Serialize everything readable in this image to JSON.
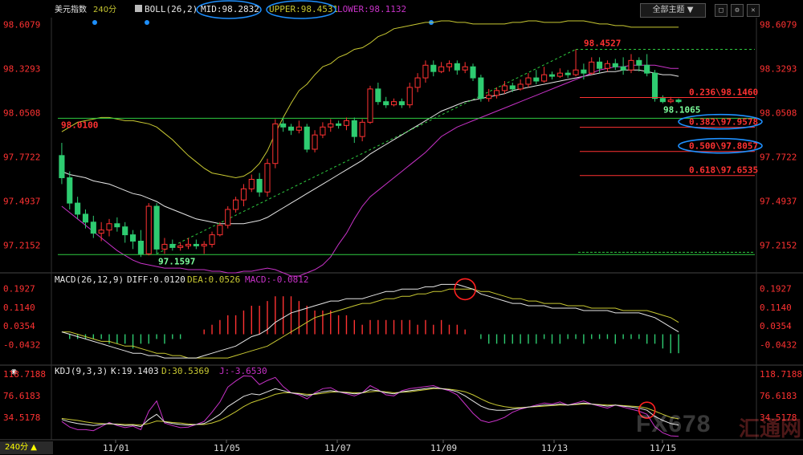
{
  "instrument": "美元指数",
  "period": "240分",
  "theme_button": "全部主题",
  "chart_data": {
    "type": "candlestick",
    "xlabels": [
      "11/01",
      "11/05",
      "11/07",
      "11/09",
      "11/13",
      "11/15"
    ],
    "y_ticks": [
      "98.6079",
      "98.3293",
      "98.0508",
      "97.7722",
      "97.4937",
      "97.2152"
    ],
    "ylim": [
      97.04,
      98.65
    ],
    "candles": [
      [
        97.78,
        97.64,
        97.86,
        97.6
      ],
      [
        97.64,
        97.48,
        97.68,
        97.44
      ],
      [
        97.48,
        97.41,
        97.52,
        97.38
      ],
      [
        97.41,
        97.36,
        97.44,
        97.32
      ],
      [
        97.36,
        97.29,
        97.4,
        97.26
      ],
      [
        97.29,
        97.31,
        97.36,
        97.24
      ],
      [
        97.31,
        97.35,
        97.38,
        97.27
      ],
      [
        97.35,
        97.33,
        97.39,
        97.3
      ],
      [
        97.33,
        97.28,
        97.36,
        97.23
      ],
      [
        97.28,
        97.24,
        97.31,
        97.19
      ],
      [
        97.24,
        97.16,
        97.31,
        97.14
      ],
      [
        97.16,
        97.46,
        97.48,
        97.15
      ],
      [
        97.46,
        97.19,
        97.48,
        97.16
      ],
      [
        97.19,
        97.22,
        97.26,
        97.16
      ],
      [
        97.22,
        97.2,
        97.25,
        97.18
      ],
      [
        97.2,
        97.21,
        97.23,
        97.18
      ],
      [
        97.21,
        97.22,
        97.26,
        97.19
      ],
      [
        97.22,
        97.21,
        97.25,
        97.19
      ],
      [
        97.21,
        97.22,
        97.24,
        97.16
      ],
      [
        97.22,
        97.28,
        97.3,
        97.2
      ],
      [
        97.28,
        97.34,
        97.36,
        97.27
      ],
      [
        97.34,
        97.44,
        97.46,
        97.32
      ],
      [
        97.44,
        97.5,
        97.52,
        97.42
      ],
      [
        97.5,
        97.57,
        97.6,
        97.46
      ],
      [
        97.57,
        97.63,
        97.66,
        97.55
      ],
      [
        97.63,
        97.55,
        97.67,
        97.52
      ],
      [
        97.55,
        97.73,
        97.76,
        97.52
      ],
      [
        97.73,
        97.98,
        98.01,
        97.7
      ],
      [
        97.98,
        97.96,
        98.02,
        97.93
      ],
      [
        97.96,
        97.94,
        97.98,
        97.91
      ],
      [
        97.94,
        97.96,
        98.0,
        97.92
      ],
      [
        97.96,
        97.82,
        97.98,
        97.8
      ],
      [
        97.82,
        97.91,
        97.94,
        97.8
      ],
      [
        97.91,
        97.96,
        97.99,
        97.89
      ],
      [
        97.96,
        97.98,
        98.01,
        97.93
      ],
      [
        97.98,
        97.97,
        98.0,
        97.95
      ],
      [
        97.97,
        98.0,
        98.02,
        97.94
      ],
      [
        98.0,
        97.9,
        98.02,
        97.86
      ],
      [
        97.9,
        97.99,
        98.01,
        97.87
      ],
      [
        97.99,
        98.2,
        98.22,
        97.98
      ],
      [
        98.2,
        98.12,
        98.24,
        98.1
      ],
      [
        98.12,
        98.1,
        98.15,
        98.08
      ],
      [
        98.1,
        98.12,
        98.14,
        98.09
      ],
      [
        98.12,
        98.1,
        98.14,
        98.08
      ],
      [
        98.1,
        98.21,
        98.24,
        98.08
      ],
      [
        98.21,
        98.27,
        98.3,
        98.18
      ],
      [
        98.27,
        98.35,
        98.38,
        98.24
      ],
      [
        98.35,
        98.31,
        98.38,
        98.28
      ],
      [
        98.31,
        98.34,
        98.37,
        98.3
      ],
      [
        98.34,
        98.36,
        98.38,
        98.31
      ],
      [
        98.36,
        98.32,
        98.38,
        98.29
      ],
      [
        98.32,
        98.34,
        98.37,
        98.3
      ],
      [
        98.34,
        98.27,
        98.36,
        98.25
      ],
      [
        98.27,
        98.14,
        98.29,
        98.12
      ],
      [
        98.14,
        98.16,
        98.2,
        98.12
      ],
      [
        98.16,
        98.19,
        98.21,
        98.14
      ],
      [
        98.19,
        98.22,
        98.25,
        98.17
      ],
      [
        98.22,
        98.2,
        98.24,
        98.18
      ],
      [
        98.2,
        98.23,
        98.26,
        98.19
      ],
      [
        98.23,
        98.27,
        98.3,
        98.21
      ],
      [
        98.27,
        98.25,
        98.32,
        98.23
      ],
      [
        98.25,
        98.29,
        98.34,
        98.24
      ],
      [
        98.29,
        98.28,
        98.31,
        98.26
      ],
      [
        98.28,
        98.3,
        98.33,
        98.27
      ],
      [
        98.3,
        98.29,
        98.32,
        98.27
      ],
      [
        98.29,
        98.32,
        98.45,
        98.28
      ],
      [
        98.32,
        98.3,
        98.36,
        98.26
      ],
      [
        98.3,
        98.37,
        98.4,
        98.29
      ],
      [
        98.37,
        98.33,
        98.4,
        98.3
      ],
      [
        98.33,
        98.36,
        98.38,
        98.31
      ],
      [
        98.36,
        98.34,
        98.39,
        98.32
      ],
      [
        98.34,
        98.32,
        98.4,
        98.29
      ],
      [
        98.32,
        98.38,
        98.42,
        98.3
      ],
      [
        98.38,
        98.35,
        98.4,
        98.31
      ],
      [
        98.35,
        98.3,
        98.42,
        98.28
      ],
      [
        98.3,
        98.14,
        98.32,
        98.12
      ],
      [
        98.14,
        98.12,
        98.16,
        98.11
      ],
      [
        98.12,
        98.13,
        98.15,
        98.11
      ],
      [
        98.13,
        98.12,
        98.14,
        98.11
      ]
    ],
    "upper_band": [
      97.93,
      97.96,
      97.99,
      98.0,
      98.01,
      98.02,
      98.02,
      98.01,
      98.0,
      98.0,
      97.99,
      97.98,
      97.96,
      97.92,
      97.88,
      97.83,
      97.78,
      97.74,
      97.7,
      97.67,
      97.66,
      97.65,
      97.64,
      97.65,
      97.68,
      97.73,
      97.81,
      97.92,
      98.02,
      98.11,
      98.19,
      98.23,
      98.29,
      98.34,
      98.36,
      98.4,
      98.42,
      98.45,
      98.46,
      98.49,
      98.53,
      98.55,
      98.58,
      98.59,
      98.6,
      98.61,
      98.62,
      98.62,
      98.63,
      98.63,
      98.62,
      98.62,
      98.61,
      98.61,
      98.61,
      98.61,
      98.61,
      98.62,
      98.62,
      98.63,
      98.63,
      98.62,
      98.62,
      98.62,
      98.63,
      98.63,
      98.63,
      98.62,
      98.61,
      98.61,
      98.6,
      98.6,
      98.59,
      98.59,
      98.59,
      98.59,
      98.59,
      98.59,
      98.59
    ],
    "mid_band": [
      97.68,
      97.66,
      97.65,
      97.64,
      97.62,
      97.61,
      97.6,
      97.58,
      97.56,
      97.54,
      97.53,
      97.51,
      97.49,
      97.46,
      97.44,
      97.42,
      97.4,
      97.38,
      97.37,
      97.36,
      97.35,
      97.35,
      97.35,
      97.35,
      97.36,
      97.37,
      97.39,
      97.42,
      97.45,
      97.48,
      97.51,
      97.54,
      97.57,
      97.6,
      97.63,
      97.66,
      97.69,
      97.72,
      97.75,
      97.79,
      97.82,
      97.85,
      97.88,
      97.91,
      97.94,
      97.97,
      98.0,
      98.03,
      98.06,
      98.08,
      98.1,
      98.12,
      98.13,
      98.14,
      98.15,
      98.16,
      98.17,
      98.19,
      98.2,
      98.21,
      98.22,
      98.23,
      98.24,
      98.25,
      98.26,
      98.27,
      98.28,
      98.29,
      98.3,
      98.31,
      98.31,
      98.32,
      98.32,
      98.32,
      98.31,
      98.3,
      98.29,
      98.29,
      98.28
    ],
    "lower_band": [
      97.46,
      97.42,
      97.38,
      97.34,
      97.3,
      97.26,
      97.22,
      97.18,
      97.15,
      97.12,
      97.1,
      97.09,
      97.08,
      97.07,
      97.07,
      97.07,
      97.06,
      97.06,
      97.06,
      97.05,
      97.05,
      97.04,
      97.04,
      97.05,
      97.05,
      97.06,
      97.07,
      97.06,
      97.04,
      97.02,
      97.02,
      97.04,
      97.06,
      97.09,
      97.14,
      97.22,
      97.29,
      97.38,
      97.46,
      97.52,
      97.56,
      97.6,
      97.64,
      97.68,
      97.72,
      97.76,
      97.8,
      97.85,
      97.9,
      97.93,
      97.96,
      97.98,
      98.0,
      98.02,
      98.04,
      98.06,
      98.08,
      98.1,
      98.12,
      98.14,
      98.16,
      98.18,
      98.2,
      98.22,
      98.24,
      98.26,
      98.28,
      98.3,
      98.32,
      98.33,
      98.34,
      98.34,
      98.35,
      98.35,
      98.35,
      98.35,
      98.34,
      98.33,
      98.33
    ],
    "bb_label": "BOLL(26,2)",
    "mid_label": "MID:98.2832",
    "upper_label": "UPPER:98.4531",
    "lower_label": "LOWER:98.1132",
    "price_labels": {
      "high": "98.4527",
      "left": "98.0100",
      "low": "97.1597",
      "recent": "98.1065"
    },
    "fib_levels": [
      {
        "label": "0.236\\98.1460",
        "value": 98.146,
        "circled": false
      },
      {
        "label": "0.382\\97.9578",
        "value": 97.958,
        "circled": true
      },
      {
        "label": "0.500\\97.8057",
        "value": 97.806,
        "circled": true
      },
      {
        "label": "0.618\\97.6535",
        "value": 97.654,
        "circled": false
      }
    ],
    "support_lines": [
      98.015,
      97.155
    ],
    "macd": {
      "label": "MACD(26,12,9)",
      "diff_label": "DIFF:0.0120",
      "dea_label": "DEA:0.0526",
      "macd_label": "MACD:-0.0812",
      "y_ticks": [
        "0.1927",
        "0.1140",
        "0.0354",
        "-0.0432"
      ],
      "ylim": [
        -0.12,
        0.225
      ],
      "diff": [
        0.01,
        0.0,
        -0.01,
        -0.02,
        -0.03,
        -0.04,
        -0.05,
        -0.06,
        -0.07,
        -0.08,
        -0.08,
        -0.09,
        -0.09,
        -0.1,
        -0.1,
        -0.1,
        -0.1,
        -0.1,
        -0.09,
        -0.08,
        -0.07,
        -0.06,
        -0.05,
        -0.03,
        -0.01,
        0.0,
        0.02,
        0.05,
        0.07,
        0.09,
        0.1,
        0.11,
        0.12,
        0.13,
        0.14,
        0.14,
        0.15,
        0.15,
        0.15,
        0.16,
        0.17,
        0.18,
        0.18,
        0.19,
        0.19,
        0.19,
        0.2,
        0.2,
        0.21,
        0.21,
        0.21,
        0.2,
        0.19,
        0.17,
        0.16,
        0.15,
        0.14,
        0.13,
        0.13,
        0.12,
        0.12,
        0.12,
        0.11,
        0.11,
        0.11,
        0.11,
        0.1,
        0.1,
        0.1,
        0.1,
        0.09,
        0.09,
        0.09,
        0.09,
        0.08,
        0.07,
        0.05,
        0.03,
        0.01
      ],
      "dea": [
        0.01,
        0.01,
        0.0,
        -0.01,
        -0.02,
        -0.03,
        -0.03,
        -0.04,
        -0.05,
        -0.05,
        -0.06,
        -0.07,
        -0.08,
        -0.08,
        -0.09,
        -0.09,
        -0.1,
        -0.1,
        -0.1,
        -0.1,
        -0.1,
        -0.1,
        -0.09,
        -0.08,
        -0.07,
        -0.06,
        -0.05,
        -0.03,
        -0.01,
        0.01,
        0.03,
        0.05,
        0.07,
        0.08,
        0.09,
        0.1,
        0.11,
        0.12,
        0.13,
        0.13,
        0.14,
        0.15,
        0.15,
        0.16,
        0.16,
        0.17,
        0.17,
        0.18,
        0.18,
        0.19,
        0.19,
        0.19,
        0.19,
        0.18,
        0.18,
        0.17,
        0.16,
        0.15,
        0.15,
        0.14,
        0.14,
        0.13,
        0.13,
        0.13,
        0.12,
        0.12,
        0.12,
        0.11,
        0.11,
        0.11,
        0.11,
        0.1,
        0.1,
        0.1,
        0.1,
        0.09,
        0.08,
        0.07,
        0.05
      ],
      "hist": [
        0.0,
        -0.02,
        -0.02,
        -0.02,
        -0.02,
        -0.02,
        -0.04,
        -0.04,
        -0.04,
        -0.06,
        -0.04,
        -0.04,
        -0.02,
        -0.04,
        -0.02,
        -0.02,
        0.0,
        0.0,
        0.02,
        0.04,
        0.06,
        0.08,
        0.08,
        0.1,
        0.12,
        0.12,
        0.14,
        0.16,
        0.16,
        0.16,
        0.14,
        0.12,
        0.1,
        0.1,
        0.1,
        0.08,
        0.08,
        0.06,
        0.04,
        0.06,
        0.06,
        0.06,
        0.06,
        0.06,
        0.06,
        0.04,
        0.06,
        0.04,
        0.06,
        0.04,
        0.04,
        0.02,
        0.0,
        -0.02,
        -0.04,
        -0.04,
        -0.04,
        -0.04,
        -0.04,
        -0.04,
        -0.04,
        -0.02,
        -0.04,
        -0.04,
        -0.02,
        -0.02,
        -0.04,
        -0.02,
        -0.02,
        -0.02,
        -0.04,
        -0.02,
        -0.02,
        -0.02,
        -0.04,
        -0.04,
        -0.06,
        -0.08,
        -0.08
      ],
      "circle_index": 51
    },
    "kdj": {
      "label": "KDJ(9,3,3)",
      "k_label": "K:19.1403",
      "d_label": "D:30.5369",
      "j_label": "J:-3.6530",
      "y_ticks": [
        "118.7188",
        "76.6183",
        "34.5178"
      ],
      "ylim": [
        -5,
        125
      ],
      "k": [
        30,
        25,
        22,
        20,
        18,
        20,
        22,
        20,
        18,
        19,
        16,
        30,
        40,
        25,
        22,
        20,
        19,
        20,
        22,
        30,
        40,
        55,
        65,
        75,
        80,
        78,
        84,
        90,
        86,
        82,
        80,
        76,
        80,
        84,
        86,
        84,
        82,
        80,
        82,
        88,
        86,
        82,
        80,
        84,
        86,
        88,
        90,
        92,
        90,
        88,
        84,
        76,
        66,
        56,
        50,
        48,
        48,
        50,
        52,
        54,
        56,
        58,
        58,
        60,
        58,
        60,
        62,
        60,
        58,
        56,
        58,
        56,
        54,
        52,
        48,
        36,
        28,
        22,
        19
      ],
      "d": [
        32,
        30,
        28,
        25,
        23,
        22,
        21,
        21,
        20,
        20,
        19,
        22,
        27,
        26,
        24,
        23,
        21,
        20,
        20,
        23,
        28,
        36,
        45,
        55,
        63,
        68,
        73,
        79,
        82,
        82,
        81,
        79,
        79,
        81,
        83,
        84,
        83,
        82,
        82,
        84,
        85,
        84,
        82,
        83,
        84,
        86,
        88,
        90,
        90,
        89,
        87,
        84,
        78,
        70,
        63,
        58,
        55,
        53,
        53,
        54,
        55,
        56,
        57,
        58,
        58,
        59,
        60,
        60,
        59,
        58,
        58,
        57,
        56,
        55,
        52,
        46,
        40,
        34,
        31
      ],
      "j": [
        26,
        15,
        10,
        10,
        8,
        16,
        24,
        18,
        14,
        17,
        10,
        46,
        66,
        23,
        18,
        14,
        15,
        20,
        26,
        44,
        64,
        93,
        105,
        115,
        114,
        98,
        106,
        112,
        94,
        82,
        78,
        70,
        82,
        90,
        92,
        84,
        80,
        76,
        82,
        96,
        88,
        78,
        76,
        86,
        90,
        92,
        94,
        96,
        90,
        86,
        78,
        60,
        42,
        28,
        24,
        28,
        34,
        44,
        50,
        54,
        58,
        62,
        60,
        64,
        58,
        62,
        66,
        60,
        56,
        52,
        58,
        54,
        50,
        46,
        40,
        16,
        4,
        -2,
        -3
      ],
      "circle_index": 74
    }
  },
  "watermark": {
    "brand": "FX678",
    "cn": "汇通网"
  },
  "colors": {
    "up": "#ff3232",
    "down": "#2ecc71",
    "upper": "#c8c832",
    "mid": "#e6e6e6",
    "lower": "#c832c8",
    "fib": "#ff3232",
    "support": "#2ecc40",
    "circle": "#1e90ff",
    "redcircle": "#ff2020",
    "tick": "#ff3232"
  }
}
